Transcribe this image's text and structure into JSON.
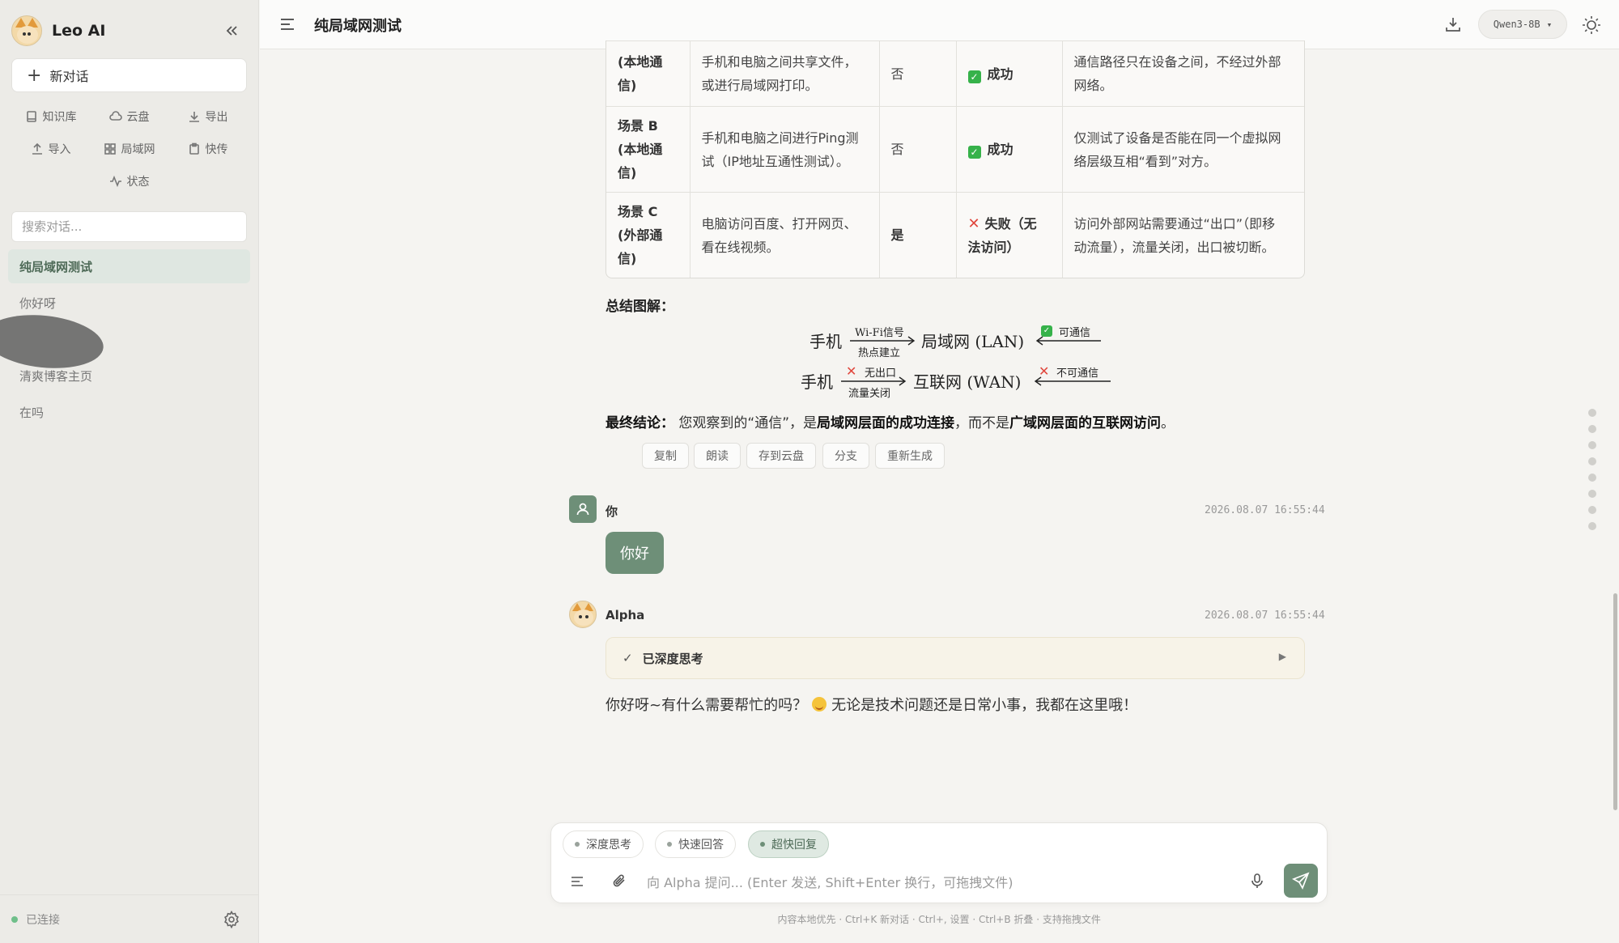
{
  "app": {
    "name": "Leo AI"
  },
  "sidebar": {
    "new_chat": "新对话",
    "tools": [
      {
        "label": "知识库",
        "icon": "book-icon"
      },
      {
        "label": "云盘",
        "icon": "cloud-icon"
      },
      {
        "label": "导出",
        "icon": "download-icon"
      },
      {
        "label": "导入",
        "icon": "upload-icon"
      },
      {
        "label": "局域网",
        "icon": "grid-icon"
      },
      {
        "label": "快传",
        "icon": "clipboard-icon"
      },
      {
        "label": "状态",
        "icon": "activity-icon"
      }
    ],
    "search_placeholder": "搜索对话...",
    "conversations": [
      "纯局域网测试",
      "你好呀",
      "清爽博客主页",
      "在吗"
    ],
    "connection": "已连接"
  },
  "header": {
    "title": "纯局域网测试",
    "model": "Qwen3-8B"
  },
  "table": {
    "rows": [
      {
        "scene": [
          "(本地通",
          "信)"
        ],
        "desc": [
          "手机和电脑之间共享文件，",
          "或进行局域网打印。"
        ],
        "internet": "否",
        "result": [
          "成功"
        ],
        "result_ok": true,
        "note": [
          "通信路径只在设备之间，不经过外部",
          "网络。"
        ]
      },
      {
        "scene": [
          "场景 B",
          "(本地通",
          "信)"
        ],
        "desc": [
          "手机和电脑之间进行Ping测",
          "试（IP地址互通性测试）。"
        ],
        "internet": "否",
        "result": [
          "成功"
        ],
        "result_ok": true,
        "note": [
          "仅测试了设备是否能在同一个虚拟网",
          "络层级互相“看到”对方。"
        ]
      },
      {
        "scene": [
          "场景 C",
          "(外部通",
          "信)"
        ],
        "desc": [
          "电脑访问百度、打开网页、",
          "看在线视频。"
        ],
        "internet": "是",
        "result": [
          "失败（无",
          "法访问）"
        ],
        "result_ok": false,
        "note": [
          "访问外部网站需要通过“出口”（即移",
          "动流量），流量关闭，出口被切断。"
        ]
      }
    ]
  },
  "summary": {
    "title": "总结图解：",
    "line1": {
      "left": "手机",
      "arrow_top": "Wi-Fi信号",
      "arrow_bottom": "热点建立",
      "middle": "局域网 (LAN)",
      "right_label": "可通信"
    },
    "line2": {
      "left": "手机",
      "arrow_top": "无出口",
      "arrow_bottom": "流量关闭",
      "middle": "互联网 (WAN)",
      "right_label": "不可通信"
    }
  },
  "conclusion": {
    "label": "最终结论：",
    "p1": "您观察到的“通信”，是",
    "b1": "局域网层面的成功连接",
    "p2": "，而不是",
    "b2": "广域网层面的互联网访问",
    "p3": "。"
  },
  "actions": [
    "复制",
    "朗读",
    "存到云盘",
    "分支",
    "重新生成"
  ],
  "messages": {
    "user": {
      "name": "你",
      "time": "2026.08.07 16:55:44",
      "text": "你好"
    },
    "ai": {
      "name": "Alpha",
      "time": "2026.08.07 16:55:44",
      "thinking": "已深度思考",
      "text_a": "你好呀~有什么需要帮忙的吗？",
      "text_b": "无论是技术问题还是日常小事，我都在这里哦！"
    }
  },
  "input": {
    "chips": [
      "深度思考",
      "快速回答",
      "超快回复"
    ],
    "placeholder": "向 Alpha 提问... (Enter 发送, Shift+Enter 换行，可拖拽文件)"
  },
  "hint": "内容本地优先 · Ctrl+K 新对话 · Ctrl+, 设置 · Ctrl+B 折叠 · 支持拖拽文件",
  "colors": {
    "accent": "#6e8f78",
    "ok": "#36b24a",
    "fail": "#e0463c"
  }
}
